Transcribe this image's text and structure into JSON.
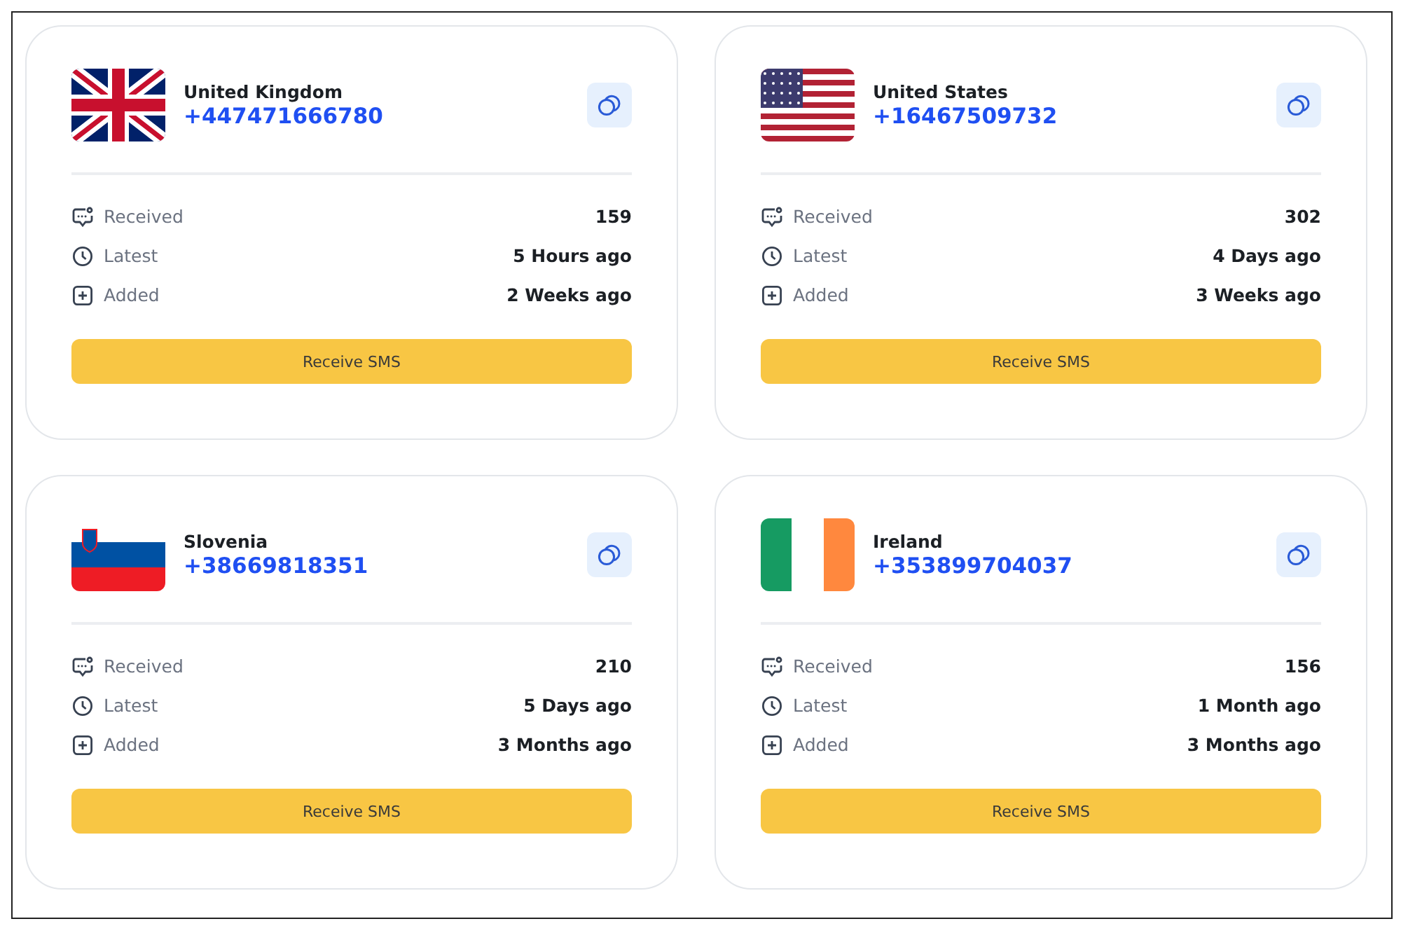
{
  "cards": [
    {
      "kind": "uk",
      "country": "United Kingdom",
      "number": "+447471666780",
      "stats": [
        {
          "kind": "received",
          "label": "Received",
          "value": "159"
        },
        {
          "kind": "latest",
          "label": "Latest",
          "value": "5 Hours ago"
        },
        {
          "kind": "added",
          "label": "Added",
          "value": "2 Weeks ago"
        }
      ],
      "button": "Receive SMS"
    },
    {
      "kind": "us",
      "country": "United States",
      "number": "+16467509732",
      "stats": [
        {
          "kind": "received",
          "label": "Received",
          "value": "302"
        },
        {
          "kind": "latest",
          "label": "Latest",
          "value": "4 Days ago"
        },
        {
          "kind": "added",
          "label": "Added",
          "value": "3 Weeks ago"
        }
      ],
      "button": "Receive SMS"
    },
    {
      "kind": "si",
      "country": "Slovenia",
      "number": "+38669818351",
      "stats": [
        {
          "kind": "received",
          "label": "Received",
          "value": "210"
        },
        {
          "kind": "latest",
          "label": "Latest",
          "value": "5 Days ago"
        },
        {
          "kind": "added",
          "label": "Added",
          "value": "3 Months ago"
        }
      ],
      "button": "Receive SMS"
    },
    {
      "kind": "ie",
      "country": "Ireland",
      "number": "+353899704037",
      "stats": [
        {
          "kind": "received",
          "label": "Received",
          "value": "156"
        },
        {
          "kind": "latest",
          "label": "Latest",
          "value": "1 Month ago"
        },
        {
          "kind": "added",
          "label": "Added",
          "value": "3 Months ago"
        }
      ],
      "button": "Receive SMS"
    }
  ]
}
